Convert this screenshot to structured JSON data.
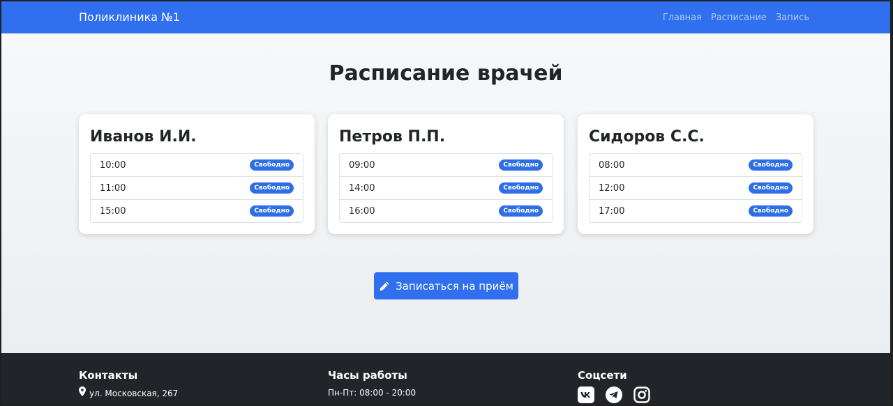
{
  "navbar": {
    "brand": "Поликлиника №1",
    "links": [
      "Главная",
      "Расписание",
      "Запись"
    ]
  },
  "page_title": "Расписание врачей",
  "doctors": [
    {
      "name": "Иванов И.И.",
      "slots": [
        {
          "time": "10:00",
          "status": "Свободно"
        },
        {
          "time": "11:00",
          "status": "Свободно"
        },
        {
          "time": "15:00",
          "status": "Свободно"
        }
      ]
    },
    {
      "name": "Петров П.П.",
      "slots": [
        {
          "time": "09:00",
          "status": "Свободно"
        },
        {
          "time": "14:00",
          "status": "Свободно"
        },
        {
          "time": "16:00",
          "status": "Свободно"
        }
      ]
    },
    {
      "name": "Сидоров С.С.",
      "slots": [
        {
          "time": "08:00",
          "status": "Свободно"
        },
        {
          "time": "12:00",
          "status": "Свободно"
        },
        {
          "time": "17:00",
          "status": "Свободно"
        }
      ]
    }
  ],
  "cta": {
    "label": "Записаться на приём",
    "icon": "pencil-icon"
  },
  "footer": {
    "contacts": {
      "title": "Контакты",
      "address": "ул. Московская, 267",
      "icon": "map-pin-icon"
    },
    "hours": {
      "title": "Часы работы",
      "weekdays": "Пн-Пт: 08:00 - 20:00"
    },
    "socials": {
      "title": "Соцсети",
      "icons": [
        "vk-icon",
        "telegram-icon",
        "instagram-icon"
      ]
    }
  },
  "colors": {
    "primary": "#3070ef",
    "badge": "#2f6fe6",
    "footer_bg": "#212529",
    "text": "#212529"
  }
}
